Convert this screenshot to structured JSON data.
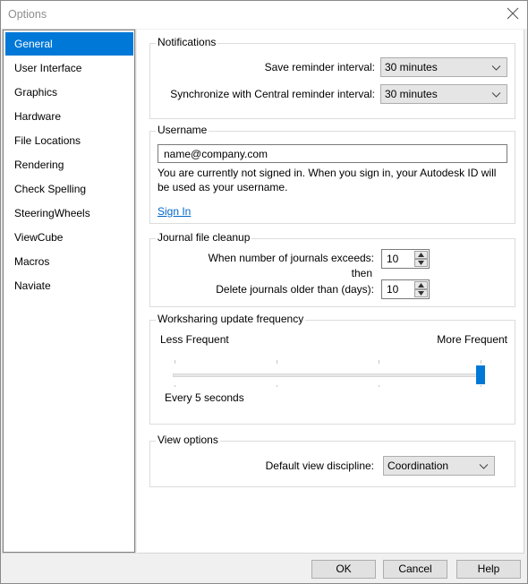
{
  "window": {
    "title": "Options"
  },
  "sidebar": {
    "items": [
      {
        "label": "General",
        "active": true
      },
      {
        "label": "User Interface"
      },
      {
        "label": "Graphics"
      },
      {
        "label": "Hardware"
      },
      {
        "label": "File Locations"
      },
      {
        "label": "Rendering"
      },
      {
        "label": "Check Spelling"
      },
      {
        "label": "SteeringWheels"
      },
      {
        "label": "ViewCube"
      },
      {
        "label": "Macros"
      },
      {
        "label": "Naviate"
      }
    ]
  },
  "notifications": {
    "title": "Notifications",
    "save_label": "Save reminder interval:",
    "save_value": "30 minutes",
    "sync_label": "Synchronize with Central reminder interval:",
    "sync_value": "30 minutes"
  },
  "username": {
    "title": "Username",
    "value": "name@company.com",
    "info": "You are currently not signed in. When you sign in, your Autodesk ID will be used as your username.",
    "sign_in": "Sign In"
  },
  "journal": {
    "title": "Journal file cleanup",
    "exceeds_label": "When number of journals exceeds:",
    "exceeds_value": "10",
    "then_label": "then",
    "delete_label": "Delete journals older than (days):",
    "delete_value": "10"
  },
  "worksharing": {
    "title": "Worksharing update frequency",
    "less_label": "Less Frequent",
    "more_label": "More Frequent",
    "status": "Every 5 seconds",
    "slider_position_fraction": 1.0,
    "slider_steps": 4
  },
  "view_options": {
    "title": "View options",
    "discipline_label": "Default view discipline:",
    "discipline_value": "Coordination"
  },
  "buttons": {
    "ok": "OK",
    "cancel": "Cancel",
    "help": "Help"
  },
  "colors": {
    "accent": "#0078d7",
    "link": "#0066cc"
  }
}
